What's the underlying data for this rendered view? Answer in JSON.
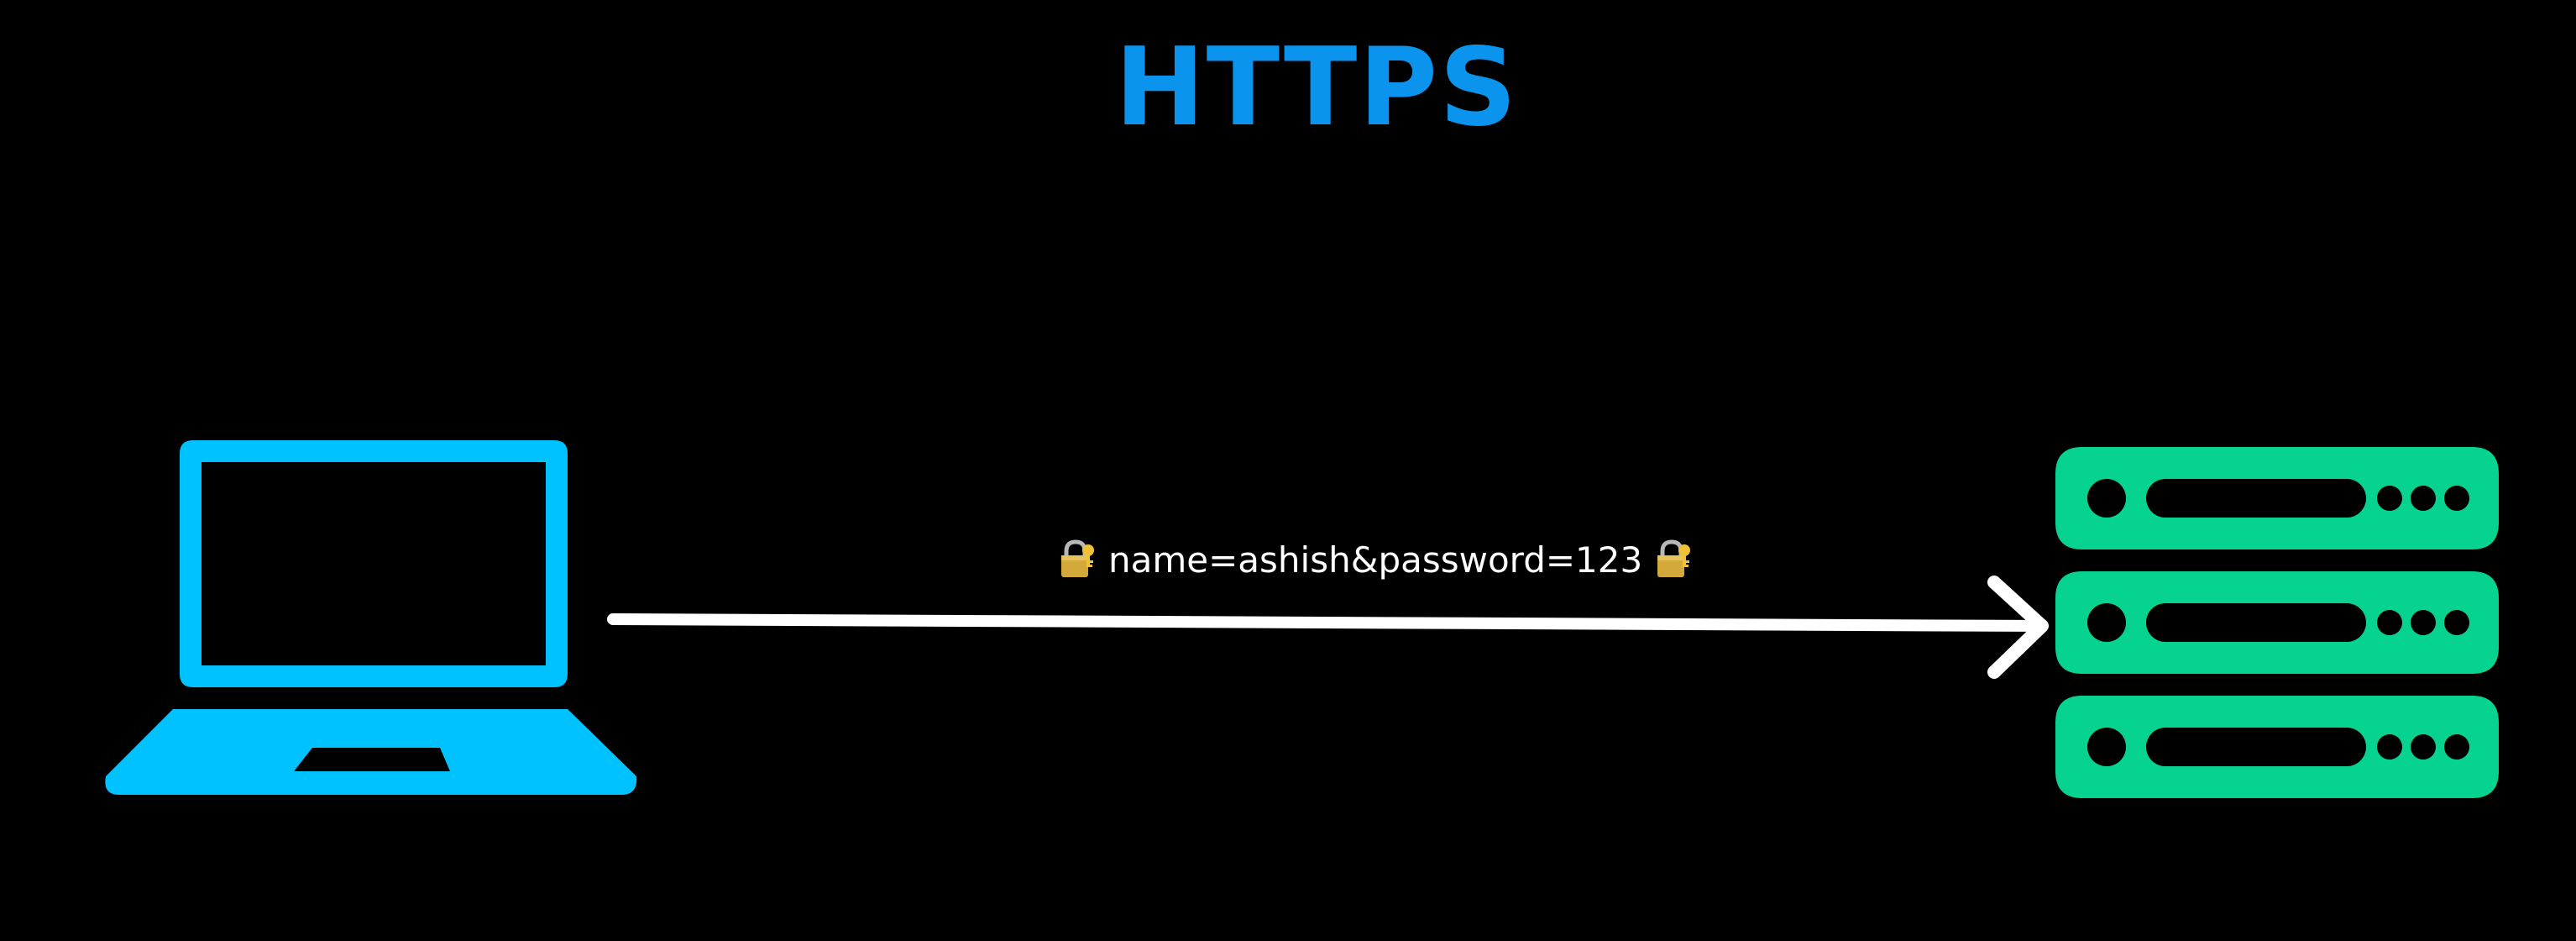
{
  "title": "HTTPS",
  "message": {
    "text": "name=ashish&password=123",
    "lock_icon": "locked-with-key-icon"
  },
  "colors": {
    "background": "#000000",
    "title": "#0a94ee",
    "client": "#00c2ff",
    "server": "#06d390",
    "arrow": "#ffffff",
    "text": "#ffffff"
  },
  "nodes": {
    "client_icon": "laptop-icon",
    "server_icon": "server-rack-icon"
  }
}
